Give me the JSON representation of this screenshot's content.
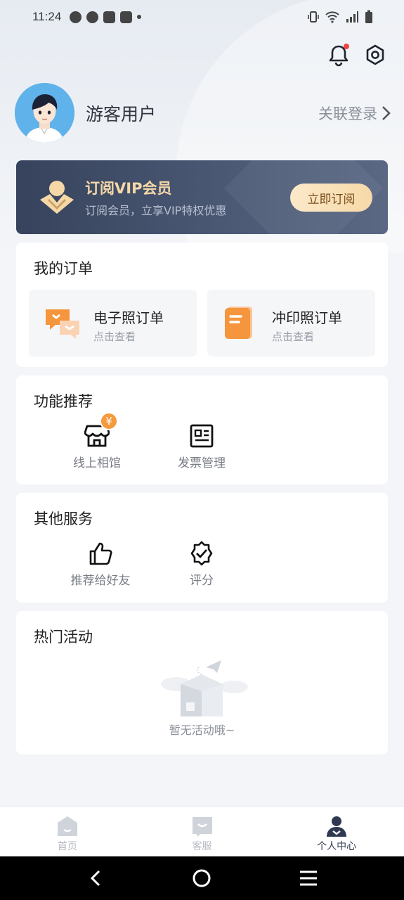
{
  "status_bar": {
    "time": "11:24"
  },
  "profile": {
    "username": "游客用户",
    "login_link": "关联登录"
  },
  "vip": {
    "title": "订阅VIP会员",
    "subtitle": "订阅会员，立享VIP特权优惠",
    "button": "立即订阅"
  },
  "orders": {
    "title": "我的订单",
    "items": [
      {
        "name": "电子照订单",
        "hint": "点击查看",
        "icon": "chat-bubbles-icon"
      },
      {
        "name": "冲印照订单",
        "hint": "点击查看",
        "icon": "document-icon"
      }
    ]
  },
  "features": {
    "title": "功能推荐",
    "items": [
      {
        "label": "线上相馆",
        "icon": "store-icon",
        "badge": "¥"
      },
      {
        "label": "发票管理",
        "icon": "invoice-icon"
      }
    ]
  },
  "services": {
    "title": "其他服务",
    "items": [
      {
        "label": "推荐给好友",
        "icon": "thumbs-up-icon"
      },
      {
        "label": "评分",
        "icon": "rating-badge-icon"
      }
    ]
  },
  "activities": {
    "title": "热门活动",
    "empty_text": "暂无活动哦~"
  },
  "tabbar": {
    "tabs": [
      {
        "label": "首页",
        "icon": "home-icon",
        "active": false
      },
      {
        "label": "客服",
        "icon": "service-icon",
        "active": false
      },
      {
        "label": "个人中心",
        "icon": "profile-icon",
        "active": true
      }
    ]
  },
  "colors": {
    "vip_gold": "#f6d8a7",
    "orange": "#f5953d",
    "dark_navy": "#37435c"
  }
}
